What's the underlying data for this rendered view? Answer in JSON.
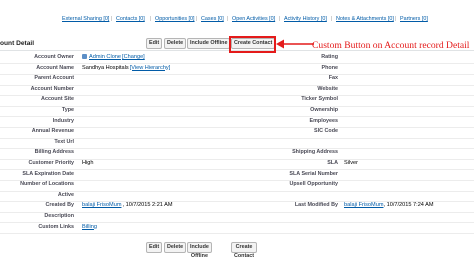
{
  "related_links": [
    {
      "label": "External Sharing [0]"
    },
    {
      "label": "Contacts [0]"
    },
    {
      "label": "Opportunities [0]"
    },
    {
      "label": "Cases [0]"
    },
    {
      "label": "Open Activities [0]"
    },
    {
      "label": "Activity History [0]"
    },
    {
      "label": "Notes & Attachments [0]"
    },
    {
      "label": "Partners [0]"
    }
  ],
  "section_title": "ount Detail",
  "buttons": {
    "edit": "Edit",
    "delete": "Delete",
    "include_offline": "Include Offline",
    "create_contact": "Create Contact"
  },
  "bottom_buttons": {
    "edit": "Edit",
    "delete": "Delete",
    "include_offline": "Include Offline",
    "create_contact": "Create Contact"
  },
  "annotation": "Custom Button on Account record Detail",
  "colors": {
    "annotation": "#e41a1a",
    "link": "#015ba7"
  },
  "left_fields": [
    {
      "label": "Account Owner",
      "value": "Admin Clone",
      "extra": "[Change]",
      "link": true,
      "icon": "user-icon"
    },
    {
      "label": "Account Name",
      "value": "Sandhya Hospitals",
      "extra": "[View Hierarchy]",
      "link": false
    },
    {
      "label": "Parent Account",
      "value": ""
    },
    {
      "label": "Account Number",
      "value": ""
    },
    {
      "label": "Account Site",
      "value": ""
    },
    {
      "label": "Type",
      "value": ""
    },
    {
      "label": "Industry",
      "value": ""
    },
    {
      "label": "Annual Revenue",
      "value": ""
    },
    {
      "label": "Text Url",
      "value": ""
    },
    {
      "label": "Billing Address",
      "value": ""
    },
    {
      "label": "Customer Priority",
      "value": "High"
    },
    {
      "label": "SLA Expiration Date",
      "value": ""
    },
    {
      "label": "Number of Locations",
      "value": ""
    },
    {
      "label": "Active",
      "value": ""
    },
    {
      "label": "Created By",
      "value": "balaji FrisoMum",
      "extra": ", 10/7/2015 2:21 AM",
      "link": true
    },
    {
      "label": "Description",
      "value": ""
    },
    {
      "label": "Custom Links",
      "value": "Billing",
      "link": true
    }
  ],
  "right_fields": [
    {
      "label": "Rating",
      "value": ""
    },
    {
      "label": "Phone",
      "value": ""
    },
    {
      "label": "Fax",
      "value": ""
    },
    {
      "label": "Website",
      "value": ""
    },
    {
      "label": "Ticker Symbol",
      "value": ""
    },
    {
      "label": "Ownership",
      "value": ""
    },
    {
      "label": "Employees",
      "value": ""
    },
    {
      "label": "SIC Code",
      "value": ""
    },
    {
      "label": "",
      "value": ""
    },
    {
      "label": "Shipping Address",
      "value": ""
    },
    {
      "label": "SLA",
      "value": "Silver"
    },
    {
      "label": "SLA Serial Number",
      "value": ""
    },
    {
      "label": "Upsell Opportunity",
      "value": ""
    },
    {
      "label": "",
      "value": ""
    },
    {
      "label": "Last Modified By",
      "value": "balaji FrisoMum",
      "extra": ", 10/7/2015 7:24 AM",
      "link": true
    },
    {
      "label": "",
      "value": ""
    },
    {
      "label": "",
      "value": ""
    }
  ]
}
